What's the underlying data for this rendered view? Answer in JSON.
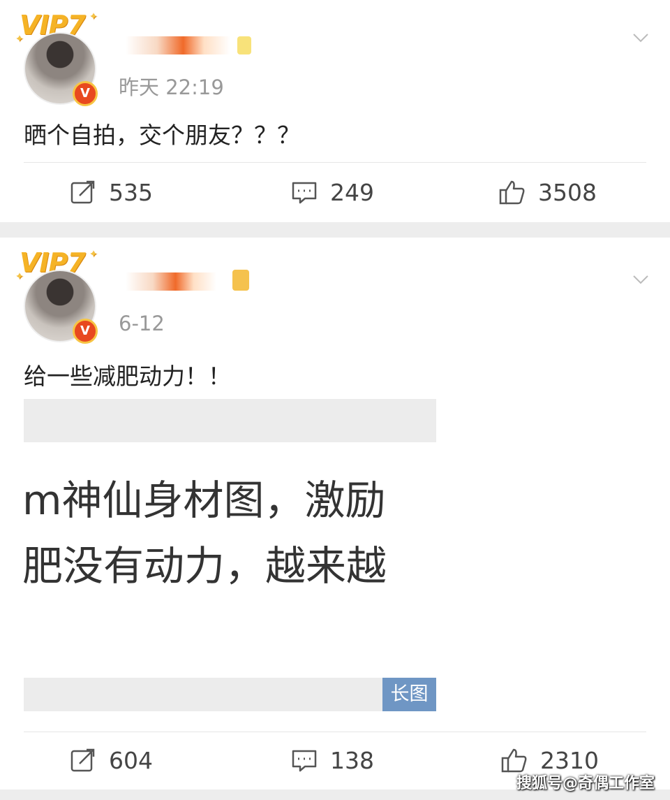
{
  "posts": [
    {
      "vip_label": "VIP7",
      "verified_badge": "V",
      "time": "昨天 22:19",
      "text": "晒个自拍，交个朋友？？？",
      "actions": {
        "repost": "535",
        "comment": "249",
        "like": "3508"
      }
    },
    {
      "vip_label": "VIP7",
      "verified_badge": "V",
      "time": "6-12",
      "text": "给一些减肥动力！！",
      "long_image": {
        "line1": "m神仙身材图，激励",
        "line2": "肥没有动力，越来越",
        "tag": "长图"
      },
      "actions": {
        "repost": "604",
        "comment": "138",
        "like": "2310"
      }
    }
  ],
  "watermark": "搜狐号@奇偶工作室",
  "colors": {
    "accent_blue": "#6f96c4",
    "vip_gold": "#f5b326",
    "badge_red": "#e8491f"
  },
  "icons": [
    "repost-icon",
    "comment-icon",
    "like-icon",
    "chevron-down-icon",
    "verified-icon"
  ]
}
